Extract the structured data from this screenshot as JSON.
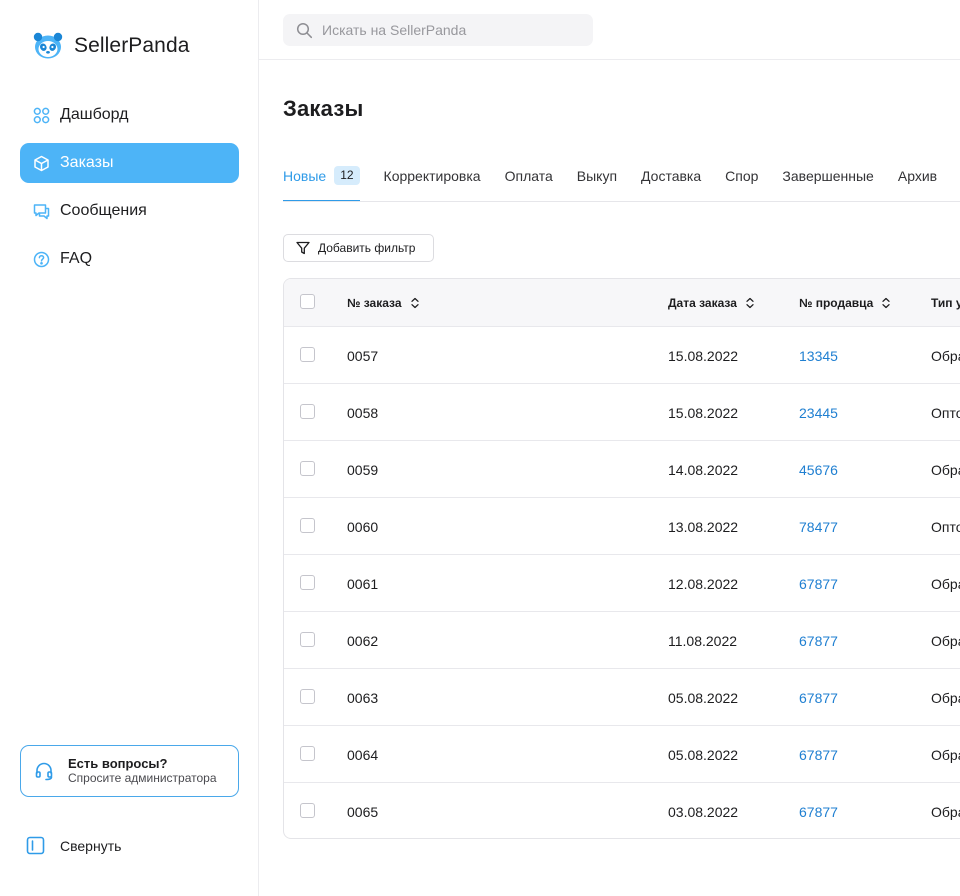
{
  "brand": {
    "name": "SellerPanda"
  },
  "sidebar": {
    "items": [
      {
        "label": "Дашборд",
        "icon": "grid-icon"
      },
      {
        "label": "Заказы",
        "icon": "box-icon",
        "active": true
      },
      {
        "label": "Сообщения",
        "icon": "chat-icon"
      },
      {
        "label": "FAQ",
        "icon": "question-icon"
      }
    ],
    "help": {
      "title": "Есть вопросы?",
      "subtitle": "Спросите администратора"
    },
    "collapse_label": "Свернуть"
  },
  "search": {
    "placeholder": "Искать на SellerPanda",
    "value": ""
  },
  "page": {
    "title": "Заказы"
  },
  "tabs": [
    {
      "label": "Новые",
      "badge": "12",
      "active": true
    },
    {
      "label": "Корректировка"
    },
    {
      "label": "Оплата"
    },
    {
      "label": "Выкуп"
    },
    {
      "label": "Доставка"
    },
    {
      "label": "Спор"
    },
    {
      "label": "Завершенные"
    },
    {
      "label": "Архив"
    }
  ],
  "filter": {
    "label": "Добавить фильтр"
  },
  "table": {
    "columns": [
      "№ заказа",
      "Дата заказа",
      "№ продавца",
      "Тип у"
    ],
    "rows": [
      {
        "order": "0057",
        "date": "15.08.2022",
        "seller": "13345",
        "type": "Обра"
      },
      {
        "order": "0058",
        "date": "15.08.2022",
        "seller": "23445",
        "type": "Опто"
      },
      {
        "order": "0059",
        "date": "14.08.2022",
        "seller": "45676",
        "type": "Обра"
      },
      {
        "order": "0060",
        "date": "13.08.2022",
        "seller": "78477",
        "type": "Опто"
      },
      {
        "order": "0061",
        "date": "12.08.2022",
        "seller": "67877",
        "type": "Обра"
      },
      {
        "order": "0062",
        "date": "11.08.2022",
        "seller": "67877",
        "type": "Обра"
      },
      {
        "order": "0063",
        "date": "05.08.2022",
        "seller": "67877",
        "type": "Обра"
      },
      {
        "order": "0064",
        "date": "05.08.2022",
        "seller": "67877",
        "type": "Обра"
      },
      {
        "order": "0065",
        "date": "03.08.2022",
        "seller": "67877",
        "type": "Обра"
      }
    ]
  },
  "colors": {
    "accent": "#4db4f7",
    "link": "#1f7fd1",
    "tab_active": "#2f9be8"
  }
}
